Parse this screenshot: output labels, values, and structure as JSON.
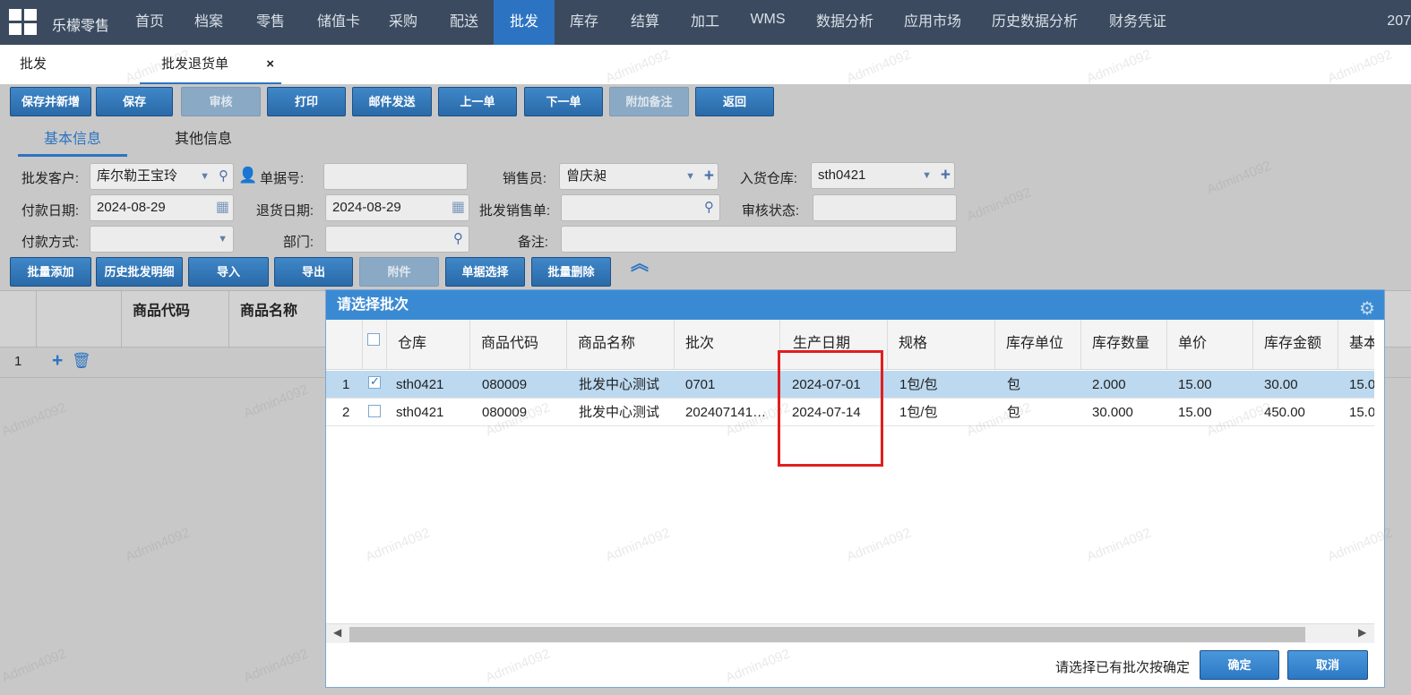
{
  "nav": {
    "brand": "乐檬零售",
    "items": [
      "首页",
      "档案",
      "零售",
      "储值卡",
      "采购",
      "配送",
      "批发",
      "库存",
      "结算",
      "加工",
      "WMS",
      "数据分析",
      "应用市场",
      "历史数据分析",
      "财务凭证"
    ],
    "active": "批发",
    "right_text": "207"
  },
  "tabs": [
    {
      "label": "批发",
      "active": false
    },
    {
      "label": "批发退货单",
      "active": true,
      "close": "×"
    }
  ],
  "toolbar": [
    "保存并新增",
    "保存",
    "审核",
    "打印",
    "邮件发送",
    "上一单",
    "下一单",
    "附加备注",
    "返回"
  ],
  "subtabs": [
    "基本信息",
    "其他信息"
  ],
  "form": {
    "customer_label": "批发客户:",
    "customer_value": "库尔勒王宝玲",
    "doc_no_label": "单据号:",
    "doc_no_value": "",
    "salesman_label": "销售员:",
    "salesman_value": "曾庆昶",
    "warehouse_label": "入货仓库:",
    "warehouse_value": "sth0421",
    "pay_date_label": "付款日期:",
    "pay_date_value": "2024-08-29",
    "return_date_label": "退货日期:",
    "return_date_value": "2024-08-29",
    "sales_order_label": "批发销售单:",
    "sales_order_value": "",
    "audit_status_label": "审核状态:",
    "audit_status_value": "",
    "pay_method_label": "付款方式:",
    "pay_method_value": "",
    "dept_label": "部门:",
    "dept_value": "",
    "remark_label": "备注:",
    "remark_value": ""
  },
  "actions": [
    "批量添加",
    "历史批发明细",
    "导入",
    "导出",
    "附件",
    "单据选择",
    "批量删除"
  ],
  "bg_grid": {
    "columns": [
      "商品代码",
      "商品名称"
    ],
    "row_index": "1"
  },
  "dialog": {
    "title": "请选择批次",
    "columns": [
      "仓库",
      "商品代码",
      "商品名称",
      "批次",
      "生产日期",
      "规格",
      "库存单位",
      "库存数量",
      "单价",
      "库存金额",
      "基本"
    ],
    "rows": [
      {
        "idx": "1",
        "checked": true,
        "cells": [
          "sth0421",
          "080009",
          "批发中心测试",
          "0701",
          "2024-07-01",
          "1包/包",
          "包",
          "2.000",
          "15.00",
          "30.00",
          "15.0"
        ]
      },
      {
        "idx": "2",
        "checked": false,
        "cells": [
          "sth0421",
          "080009",
          "批发中心测试",
          "202407141…",
          "2024-07-14",
          "1包/包",
          "包",
          "30.000",
          "15.00",
          "450.00",
          "15.0"
        ]
      }
    ],
    "footer_text": "请选择已有批次按确定",
    "ok": "确定",
    "cancel": "取消"
  },
  "watermark": "Admin4092"
}
